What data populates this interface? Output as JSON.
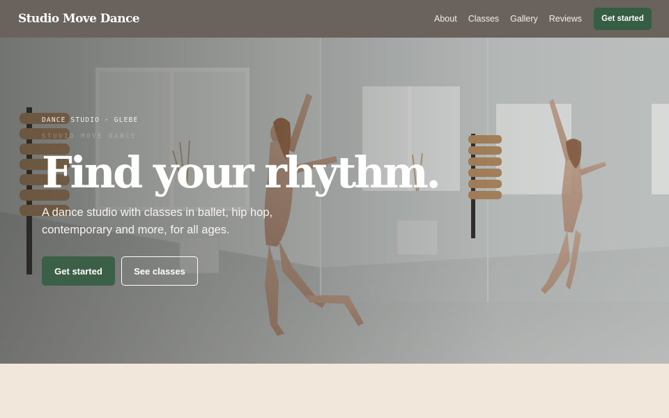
{
  "header": {
    "brand": "Studio Move Dance",
    "nav": [
      "About",
      "Classes",
      "Gallery",
      "Reviews"
    ],
    "cta_label": "Get started",
    "background": "#6a625d",
    "cta_color": "#355e45"
  },
  "hero": {
    "eyebrow": "DANCE STUDIO · GLEBE",
    "eyebrow_sub": "STUDIO MOVE DANCE",
    "headline": "Find your rhythm.",
    "subcopy": "A dance studio with classes in ballet, hip hop, contemporary and more, for all ages.",
    "primary_cta": "Get started",
    "secondary_cta": "See classes",
    "photo": "dancer in bright studio with mirror and windows"
  },
  "lower_section": {
    "background": "#f1e7da"
  }
}
